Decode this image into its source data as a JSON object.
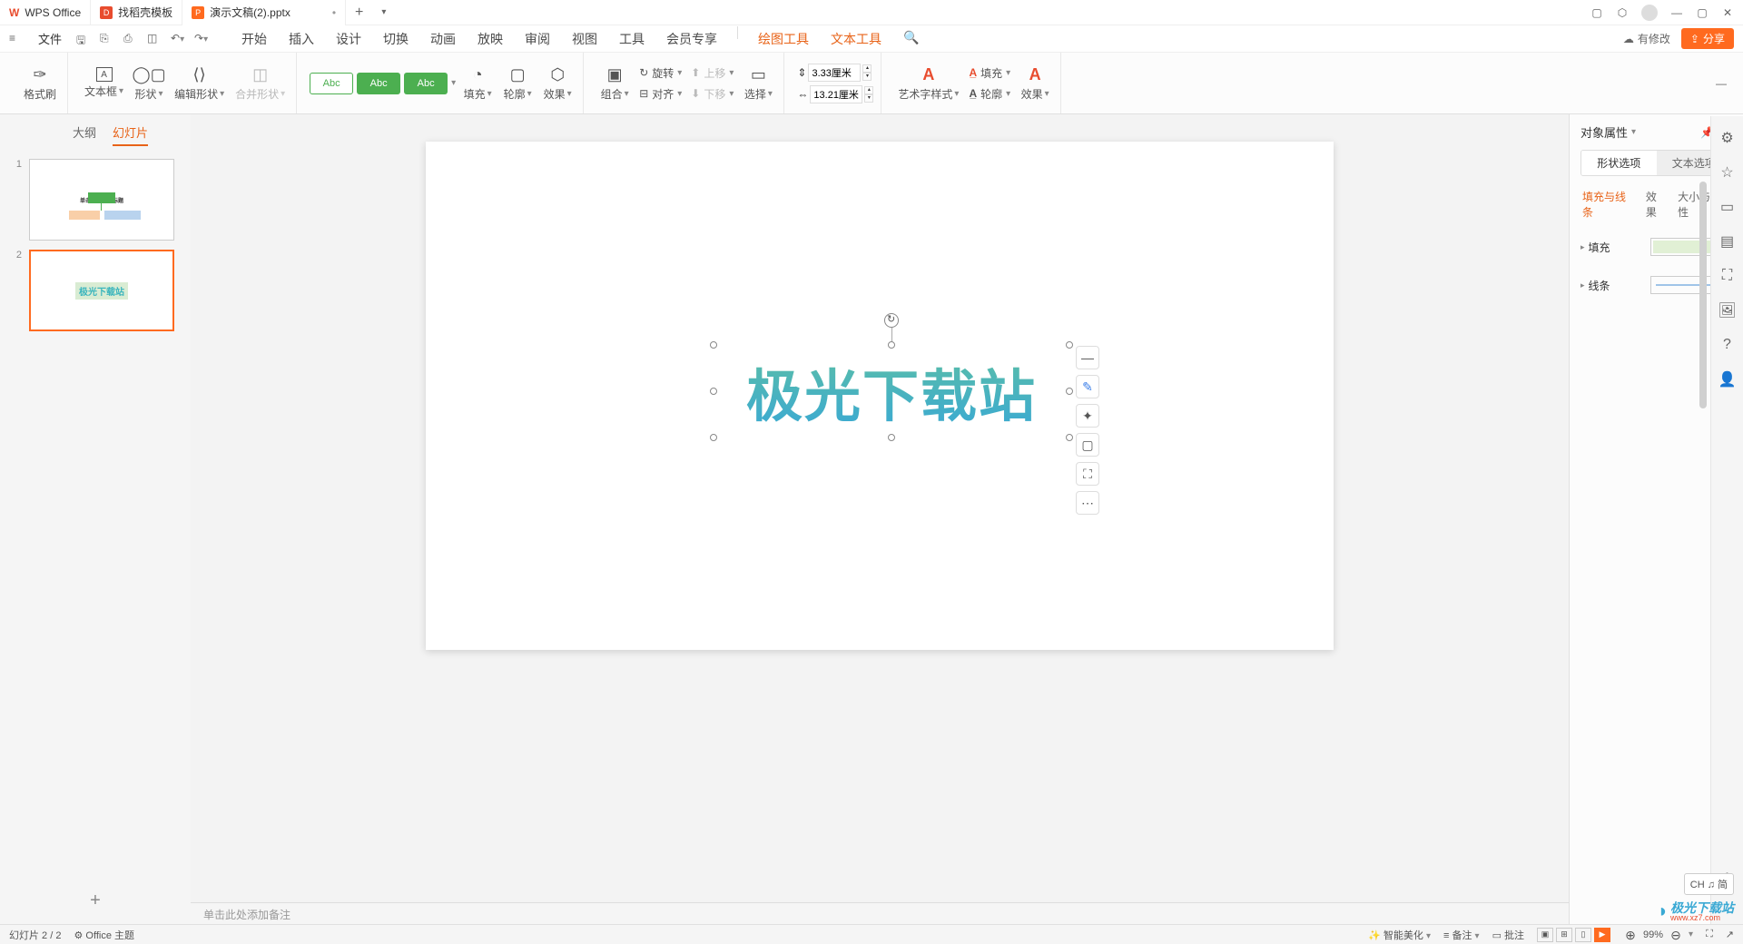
{
  "title_tabs": {
    "wps": "WPS Office",
    "templates": "找稻壳模板",
    "file": "演示文稿(2).pptx"
  },
  "menu": {
    "file_label": "文件",
    "tabs": [
      "开始",
      "插入",
      "设计",
      "切换",
      "动画",
      "放映",
      "审阅",
      "视图",
      "工具",
      "会员专享"
    ],
    "draw_tools": "绘图工具",
    "text_tools": "文本工具",
    "cloud_status": "有修改",
    "share": "分享"
  },
  "ribbon": {
    "format_brush": "格式刷",
    "text_box": "文本框",
    "shape": "形状",
    "edit_shape": "编辑形状",
    "merge_shape": "合并形状",
    "preset_label": "Abc",
    "fill": "填充",
    "outline": "轮廓",
    "effect": "效果",
    "group": "组合",
    "rotate": "旋转",
    "align": "对齐",
    "up": "上移",
    "down": "下移",
    "select": "选择",
    "height": "3.33厘米",
    "width": "13.21厘米",
    "art_style": "艺术字样式",
    "fill2": "填充",
    "outline2": "轮廓",
    "effect2": "效果"
  },
  "slide_panel": {
    "outline": "大纲",
    "slides": "幻灯片",
    "thumb1_title": "单击此处添加标题",
    "thumb2_text": "极光下载站"
  },
  "canvas": {
    "main_text": "极光下载站",
    "notes_placeholder": "单击此处添加备注"
  },
  "props": {
    "title": "对象属性",
    "shape_opts": "形状选项",
    "text_opts": "文本选项",
    "sub_fill": "填充与线条",
    "sub_effect": "效果",
    "sub_size": "大小与属性",
    "fill_label": "填充",
    "line_label": "线条"
  },
  "status": {
    "slide_info": "幻灯片 2 / 2",
    "theme": "Office 主题",
    "beautify": "智能美化",
    "notes": "备注",
    "comment": "批注",
    "zoom": "99%"
  },
  "ime": "CH ♫ 简",
  "watermark": {
    "text": "极光下载站",
    "url": "www.xz7.com"
  }
}
